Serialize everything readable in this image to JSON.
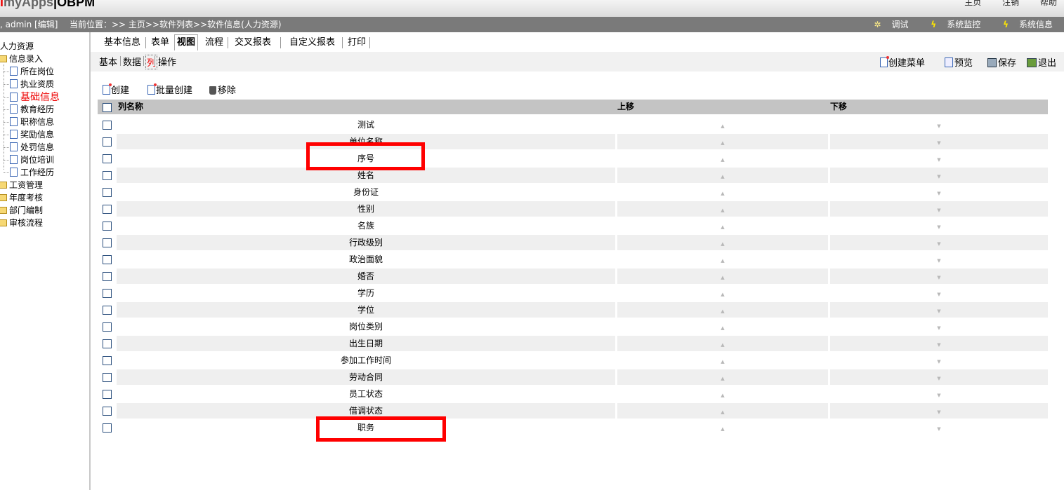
{
  "header": {
    "logo_prefix": "i",
    "logo_name": "myApps",
    "logo_sep": "|",
    "logo_brand": "OBPM",
    "links": [
      "主页",
      "注销",
      "帮助"
    ]
  },
  "infobar": {
    "user": ", admin [编辑]",
    "breadcrumb": "当前位置：>> 主页>>软件列表>>软件信息(人力资源)",
    "tools": [
      "调试",
      "系统监控",
      "系统信息"
    ]
  },
  "sidebar": {
    "root": "人力资源",
    "folder_open": "信息录入",
    "items": [
      "所在岗位",
      "执业资质",
      "基础信息",
      "教育经历",
      "职称信息",
      "奖励信息",
      "处罚信息",
      "岗位培训",
      "工作经历"
    ],
    "active_item": "基础信息",
    "folders": [
      "工资管理",
      "年度考核",
      "部门编制",
      "审核流程"
    ]
  },
  "tabs": [
    "基本信息",
    "表单",
    "视图",
    "流程",
    "交叉报表",
    "自定义报表",
    "打印"
  ],
  "active_tab": "视图",
  "subtabs": [
    "基本",
    "数据",
    "列",
    "操作"
  ],
  "active_subtab": "列",
  "actions": {
    "create_menu": "创建菜单",
    "preview": "预览",
    "save": "保存",
    "exit": "退出"
  },
  "list_tools": {
    "create": "创建",
    "batch_create": "批量创建",
    "remove": "移除"
  },
  "table": {
    "headers": [
      "列名称",
      "上移",
      "下移"
    ],
    "rows": [
      "测试",
      "单位名称",
      "序号",
      "姓名",
      "身份证",
      "性别",
      "名族",
      "行政级别",
      "政治面貌",
      "婚否",
      "学历",
      "学位",
      "岗位类别",
      "出生日期",
      "参加工作时间",
      "劳动合同",
      "员工状态",
      "借调状态",
      "职务"
    ],
    "highlighted_rows": [
      "序号",
      "职务"
    ]
  },
  "colors": {
    "accent": "#ee0000",
    "highlight": "#ff0000",
    "header_bar": "#7a7a7a",
    "table_header": "#c4c4c4"
  }
}
